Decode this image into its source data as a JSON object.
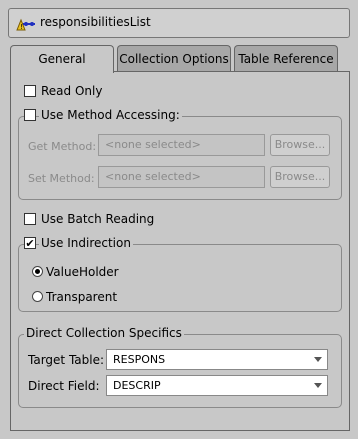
{
  "header": {
    "title": "responsibilitiesList",
    "icon": "collection-mapping-icon"
  },
  "tabs": [
    {
      "label": "General",
      "active": true
    },
    {
      "label": "Collection Options",
      "active": false
    },
    {
      "label": "Table Reference",
      "active": false
    }
  ],
  "general": {
    "read_only": {
      "label": "Read Only",
      "checked": false
    },
    "use_method_accessing": {
      "label": "Use Method Accessing:",
      "checked": false
    },
    "get_method": {
      "label": "Get Method:",
      "value": "<none selected>",
      "browse": "Browse..."
    },
    "set_method": {
      "label": "Set Method:",
      "value": "<none selected>",
      "browse": "Browse..."
    },
    "use_batch_reading": {
      "label": "Use Batch Reading",
      "checked": false
    },
    "use_indirection": {
      "label": "Use Indirection",
      "checked": true
    },
    "value_holder": {
      "label": "ValueHolder",
      "selected": true
    },
    "transparent": {
      "label": "Transparent",
      "selected": false
    },
    "direct_collection": {
      "title": "Direct Collection Specifics",
      "target_table": {
        "label": "Target Table:",
        "value": "RESPONS"
      },
      "direct_field": {
        "label": "Direct Field:",
        "value": "DESCRIP"
      }
    }
  }
}
